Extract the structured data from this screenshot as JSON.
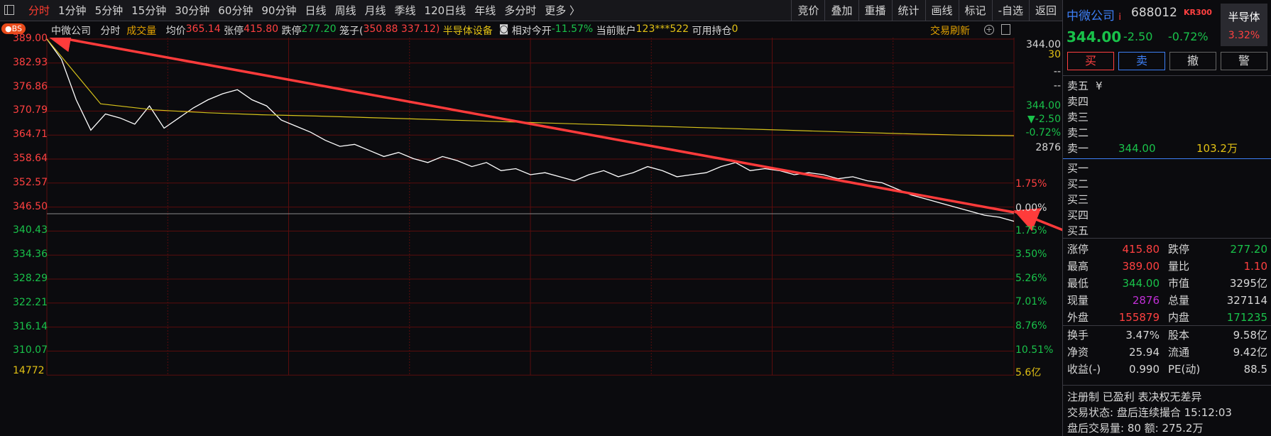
{
  "toolbar": {
    "period_tabs": [
      "分时",
      "1分钟",
      "5分钟",
      "15分钟",
      "30分钟",
      "60分钟",
      "90分钟",
      "日线",
      "周线",
      "月线",
      "季线",
      "120日线",
      "年线",
      "多分时",
      "更多 〉"
    ],
    "active_tab": "分时",
    "tool_buttons": [
      "竞价",
      "叠加",
      "重播",
      "统计",
      "画线",
      "标记",
      "-自选",
      "返回"
    ]
  },
  "info_row": {
    "badge": "●BS",
    "stock_name": "中微公司",
    "view_mode": "分时",
    "volume_label": "成交量",
    "avg_label": "均价",
    "avg_value": "365.14",
    "limit_up_label": "张停",
    "limit_up_value": "415.80",
    "limit_down_label": "跌停",
    "limit_down_value": "277.20",
    "cage_label": "笼子(",
    "cage_value": "350.88 337.12)",
    "sector": "半导体设备",
    "relative_open_label": "相对今开",
    "relative_open_value": "-11.57%",
    "account_label": "当前账户",
    "account_value": "123***522",
    "holding_label": "可用持仓",
    "holding_value": "0",
    "trade_refresh": "交易刷新"
  },
  "chart": {
    "price_axis_left": [
      "389.00",
      "382.93",
      "376.86",
      "370.79",
      "364.71",
      "358.64",
      "352.57",
      "346.50",
      "340.43",
      "334.36",
      "328.29",
      "322.21",
      "316.14",
      "310.07"
    ],
    "volume_axis_label": "14772",
    "pct_axis_right": [
      "1.75%",
      "0.00%",
      "1.75%",
      "3.50%",
      "5.26%",
      "7.01%",
      "8.76%",
      "10.51%"
    ],
    "volume_axis_right": "5.6亿",
    "right_overlay": {
      "top_price": "344.00",
      "top_num": "30",
      "dash1": "--",
      "dash2": "--",
      "price2": "344.00",
      "change": "▼-2.50",
      "pct": "-0.72%",
      "vol": "2876"
    },
    "colors": {
      "price_line": "#ffffff",
      "avg_line": "#d6c21a",
      "grid": "#5a0d0d",
      "arrow": "#ff3b3b",
      "baseline": "#8a8a8a"
    }
  },
  "chart_data": {
    "type": "line",
    "title": "",
    "xlabel": "",
    "ylabel": "",
    "ylim": [
      307.04,
      389.0
    ],
    "series": [
      {
        "name": "",
        "values": [
          389.0,
          384.0,
          374.0,
          366.5,
          370.5,
          369.5,
          368.0,
          372.5,
          367.0,
          369.5,
          372.0,
          374.0,
          375.5,
          376.5,
          374.0,
          372.5,
          369.0,
          367.5,
          366.0,
          364.0,
          362.5,
          363.0,
          361.5,
          360.0,
          361.0,
          359.5,
          358.5,
          360.0,
          359.0,
          357.5,
          358.5,
          356.5,
          357.0,
          355.5,
          356.0,
          355.0,
          354.0,
          355.5,
          356.5,
          355.0,
          356.0,
          357.5,
          356.5,
          355.0,
          355.5,
          356.0,
          357.5,
          358.5,
          356.5,
          357.0,
          356.5,
          355.5,
          356.0,
          355.5,
          354.5,
          355.0,
          354.0,
          353.5,
          352.0,
          350.5,
          349.5,
          348.5,
          347.5,
          346.5,
          345.5,
          345.0,
          344.0
        ]
      },
      {
        "name": "均价",
        "values": [
          389.0,
          373.0,
          371.5,
          370.8,
          370.3,
          370.0,
          369.6,
          369.2,
          368.8,
          368.4,
          368.0,
          367.6,
          367.2,
          366.8,
          366.4,
          366.0,
          365.6,
          365.3,
          365.14
        ]
      }
    ]
  },
  "right_panel": {
    "stock_name": "中微公司",
    "name_suffix": "i",
    "stock_code": "688012",
    "kr_badge": "KR300",
    "sector_name": "半导体",
    "sector_change": "3.32%",
    "price": "344.00",
    "change": "-2.50",
    "change_pct": "-0.72%",
    "trade_buttons": {
      "buy": "买",
      "sell": "卖",
      "cancel": "撤",
      "alert": "警"
    },
    "asks": [
      {
        "label": "卖五",
        "price": "¥",
        "vol": ""
      },
      {
        "label": "卖四",
        "price": "",
        "vol": ""
      },
      {
        "label": "卖三",
        "price": "",
        "vol": ""
      },
      {
        "label": "卖二",
        "price": "",
        "vol": ""
      },
      {
        "label": "卖一",
        "price": "344.00",
        "vol": "103.2万"
      }
    ],
    "bids": [
      {
        "label": "买一",
        "price": "",
        "vol": ""
      },
      {
        "label": "买二",
        "price": "",
        "vol": ""
      },
      {
        "label": "买三",
        "price": "",
        "vol": ""
      },
      {
        "label": "买四",
        "price": "",
        "vol": ""
      },
      {
        "label": "买五",
        "price": "",
        "vol": ""
      }
    ],
    "stats1": [
      {
        "k1": "涨停",
        "v1": "415.80",
        "c1": "#ff4040",
        "k2": "跌停",
        "v2": "277.20",
        "c2": "#19c24a"
      },
      {
        "k1": "最高",
        "v1": "389.00",
        "c1": "#ff4040",
        "k2": "量比",
        "v2": "1.10",
        "c2": "#ff4040"
      },
      {
        "k1": "最低",
        "v1": "344.00",
        "c1": "#19c24a",
        "k2": "市值",
        "v2": "3295亿",
        "c2": "#d7d7d7"
      },
      {
        "k1": "现量",
        "v1": "2876",
        "c1": "#c02fd6",
        "k2": "总量",
        "v2": "327114",
        "c2": "#d7d7d7"
      },
      {
        "k1": "外盘",
        "v1": "155879",
        "c1": "#ff4040",
        "k2": "内盘",
        "v2": "171235",
        "c2": "#19c24a"
      }
    ],
    "stats2": [
      {
        "k1": "换手",
        "v1": "3.47%",
        "c1": "#d7d7d7",
        "k2": "股本",
        "v2": "9.58亿",
        "c2": "#d7d7d7"
      },
      {
        "k1": "净资",
        "v1": "25.94",
        "c1": "#d7d7d7",
        "k2": "流通",
        "v2": "9.42亿",
        "c2": "#d7d7d7"
      },
      {
        "k1": "收益(-)",
        "v1": "0.990",
        "c1": "#d7d7d7",
        "k2": "PE(动)",
        "v2": "88.5",
        "c2": "#d7d7d7"
      }
    ],
    "notice": "注册制 已盈利 表决权无差异",
    "status": "交易状态: 盘后连续撮合 15:12:03",
    "after_hours": "盘后交易量: 80  额: 275.2万"
  }
}
